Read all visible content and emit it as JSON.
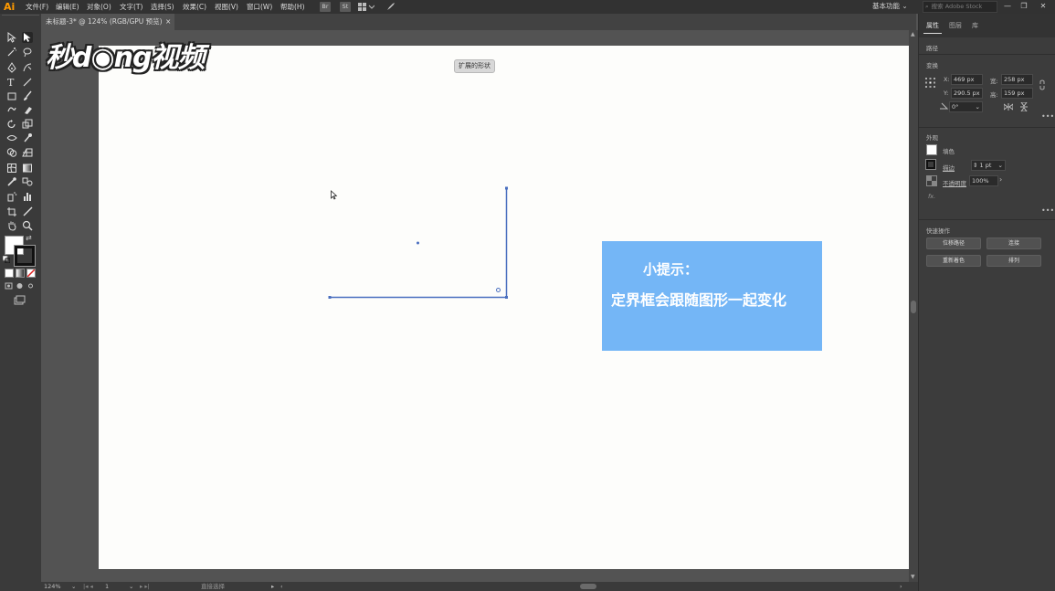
{
  "app": {
    "logo": "Ai"
  },
  "menubar": {
    "items": [
      "文件(F)",
      "编辑(E)",
      "对象(O)",
      "文字(T)",
      "选择(S)",
      "效果(C)",
      "视图(V)",
      "窗口(W)",
      "帮助(H)"
    ],
    "br_label": "Br",
    "st_label": "St",
    "workspace": "基本功能",
    "search_placeholder": "搜索 Adobe Stock",
    "minimize": "—",
    "restore": "❐",
    "close": "✕"
  },
  "tab": {
    "title": "未标题-3* @ 124% (RGB/GPU 预览)",
    "close": "×"
  },
  "watermark": "秒d◉ng视频",
  "canvas": {
    "tooltip": "扩展的形状",
    "tip_title": "小提示：",
    "tip_body": "定界框会跟随图形一起变化"
  },
  "statusbar": {
    "zoom": "124%",
    "page": "1",
    "mode": "直接选择"
  },
  "panel": {
    "tabs": [
      "属性",
      "图层",
      "库"
    ],
    "section_path": "路径",
    "section_transform": "变换",
    "x_label": "X:",
    "x_value": "469 px",
    "y_label": "Y:",
    "y_value": "290.5 px",
    "w_label": "宽:",
    "w_value": "258 px",
    "h_label": "高:",
    "h_value": "159 px",
    "angle_value": "0°",
    "section_appearance": "外观",
    "fill_label": "填色",
    "stroke_label": "描边",
    "stroke_value": "1 pt",
    "opacity_label": "不透明度",
    "opacity_value": "100%",
    "fx_label": "fx.",
    "section_quick": "快速操作",
    "btn_offset": "位移路径",
    "btn_join": "连接",
    "btn_recolor": "重新着色",
    "btn_arrange": "排列"
  },
  "colors": {
    "tip_bg": "#74b6f6",
    "path_stroke": "#4a6fbf",
    "accent_logo": "#ff9a00"
  }
}
